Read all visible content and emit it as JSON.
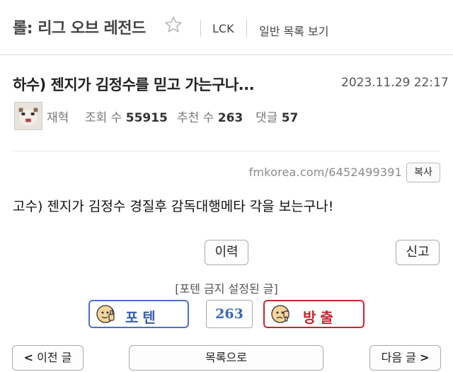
{
  "header": {
    "board_title": "롤: 리그 오브 레전드",
    "nav": [
      "LCK",
      "일반 목록 보기"
    ]
  },
  "post": {
    "title": "하수) 젠지가 김정수를 믿고 가는구나...",
    "date": "2023.11.29 22:17",
    "author": "재혁",
    "views_label": "조회 수",
    "views": "55915",
    "recommend_label": "추천 수",
    "recommend": "263",
    "comments_label": "댓글",
    "comments": "57",
    "source_url": "fmkorea.com/6452499391",
    "copy_label": "복사",
    "body": "고수) 젠지가 김정수 경질후 감독대행메타 각을 보는구나!"
  },
  "actions": {
    "history": "이력",
    "report": "신고",
    "poten_note": "[포텐 금지 설정된 글]",
    "vote_up": "포텐",
    "vote_count": "263",
    "vote_down": "방출"
  },
  "pager": {
    "prev": "이전 글",
    "list": "목록으로",
    "next": "다음 글"
  },
  "colors": {
    "vote_up": "#4a72c4",
    "vote_down": "#c8262f"
  }
}
